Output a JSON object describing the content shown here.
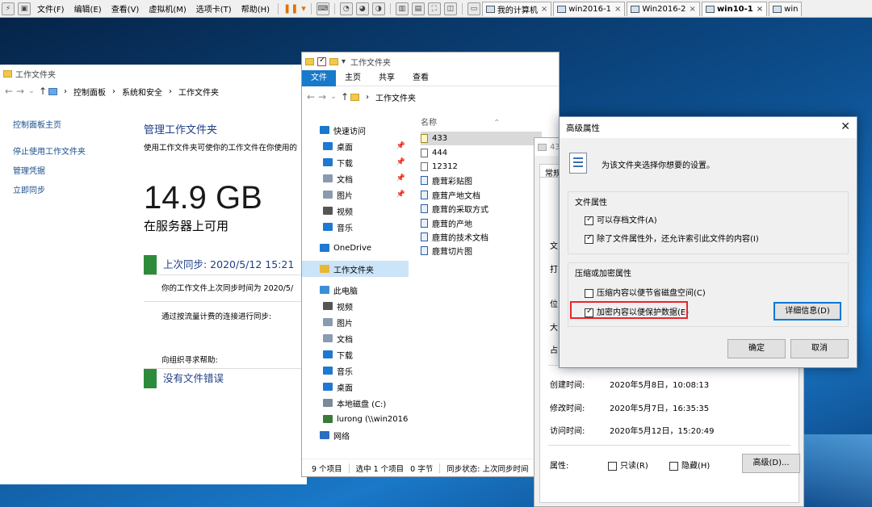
{
  "vmware": {
    "menus": [
      "文件(F)",
      "编辑(E)",
      "查看(V)",
      "虚拟机(M)",
      "选项卡(T)",
      "帮助(H)"
    ],
    "tabs": [
      {
        "label": "我的计算机",
        "active": false
      },
      {
        "label": "win2016-1",
        "active": false
      },
      {
        "label": "Win2016-2",
        "active": false
      },
      {
        "label": "win10-1",
        "active": true
      },
      {
        "label": "win",
        "active": false
      }
    ]
  },
  "control_panel": {
    "title": "工作文件夹",
    "breadcrumb": [
      "控制面板",
      "系统和安全",
      "工作文件夹"
    ],
    "left_links": [
      "控制面板主页",
      "停止使用工作文件夹",
      "管理凭据",
      "立即同步"
    ],
    "heading": "管理工作文件夹",
    "description": "使用工作文件夹可使你的工作文件在你使用的",
    "capacity": "14.9 GB",
    "capacity_label": "在服务器上可用",
    "sync_title": "上次同步: 2020/5/12 15:21",
    "sync_detail": "你的工作文件上次同步时间为 2020/5/",
    "metered_text": "通过按流量计费的连接进行同步:",
    "help_text": "向组织寻求帮助:",
    "error_title": "没有文件错误"
  },
  "explorer": {
    "title": "工作文件夹",
    "ribbon_tabs": [
      "文件",
      "主页",
      "共享",
      "查看"
    ],
    "address": "工作文件夹",
    "nav": [
      {
        "label": "快速访问",
        "icon": "star-icon",
        "color": "#1979ca",
        "pin": false
      },
      {
        "label": "桌面",
        "icon": "desktop-icon",
        "color": "#1f78d1",
        "pin": true
      },
      {
        "label": "下载",
        "icon": "download-icon",
        "color": "#1f78d1",
        "pin": true
      },
      {
        "label": "文档",
        "icon": "document-icon",
        "color": "#8a9bb0",
        "pin": true
      },
      {
        "label": "图片",
        "icon": "picture-icon",
        "color": "#8a9bb0",
        "pin": true
      },
      {
        "label": "视频",
        "icon": "video-icon",
        "color": "#555555",
        "pin": false
      },
      {
        "label": "音乐",
        "icon": "music-icon",
        "color": "#1f78d1",
        "pin": false
      },
      {
        "label": "OneDrive",
        "icon": "cloud-icon",
        "color": "#1f78d1",
        "pin": false
      },
      {
        "label": "工作文件夹",
        "icon": "work-folder-icon",
        "color": "#e9b635",
        "pin": false,
        "selected": true
      },
      {
        "label": "此电脑",
        "icon": "computer-icon",
        "color": "#3a8fd8",
        "pin": false
      },
      {
        "label": "视频",
        "icon": "video-icon",
        "color": "#555555",
        "pin": false
      },
      {
        "label": "图片",
        "icon": "picture-icon",
        "color": "#8a9bb0",
        "pin": false
      },
      {
        "label": "文档",
        "icon": "document-icon",
        "color": "#8a9bb0",
        "pin": false
      },
      {
        "label": "下载",
        "icon": "download-icon",
        "color": "#1f78d1",
        "pin": false
      },
      {
        "label": "音乐",
        "icon": "music-icon",
        "color": "#1f78d1",
        "pin": false
      },
      {
        "label": "桌面",
        "icon": "desktop-icon",
        "color": "#1f78d1",
        "pin": false
      },
      {
        "label": "本地磁盘 (C:)",
        "icon": "drive-icon",
        "color": "#7a8a99",
        "pin": false
      },
      {
        "label": "lurong (\\\\win2016",
        "icon": "network-drive-icon",
        "color": "#3b7a3b",
        "pin": false
      },
      {
        "label": "网络",
        "icon": "network-icon",
        "color": "#2a6fc0",
        "pin": false
      }
    ],
    "column_header": "名称",
    "files": [
      {
        "name": "433",
        "type": "yel",
        "selected": true
      },
      {
        "name": "444",
        "type": "plain"
      },
      {
        "name": "12312",
        "type": "plain"
      },
      {
        "name": "鹿茸彩贴图",
        "type": "blue"
      },
      {
        "name": "鹿茸产地文档",
        "type": "blue"
      },
      {
        "name": "鹿茸的采取方式",
        "type": "blue"
      },
      {
        "name": "鹿茸的产地",
        "type": "blue"
      },
      {
        "name": "鹿茸的技术文档",
        "type": "blue"
      },
      {
        "name": "鹿茸切片图",
        "type": "blue"
      }
    ],
    "status": {
      "items": "9 个项目",
      "selected": "选中 1 个项目",
      "size": "0 字节",
      "sync": "同步状态: 上次同步时间"
    }
  },
  "properties": {
    "title_fragment": "43",
    "tab": "常规",
    "partial_labels": [
      "文",
      "打",
      "位",
      "大",
      "占"
    ],
    "created_label": "创建时间:",
    "created_value": "2020年5月8日，10:08:13",
    "modified_label": "修改时间:",
    "modified_value": "2020年5月7日，16:35:35",
    "accessed_label": "访问时间:",
    "accessed_value": "2020年5月12日，15:20:49",
    "attrs_label": "属性:",
    "readonly_label": "只读(R)",
    "hidden_label": "隐藏(H)",
    "advanced_button": "高级(D)..."
  },
  "advanced_dialog": {
    "title": "高级属性",
    "description": "为该文件夹选择你想要的设置。",
    "file_attr_group": "文件属性",
    "archive_label": "可以存档文件(A)",
    "archive_checked": true,
    "index_label": "除了文件属性外，还允许索引此文件的内容(I)",
    "index_checked": true,
    "compress_group": "压缩或加密属性",
    "compress_label": "压缩内容以便节省磁盘空间(C)",
    "compress_checked": false,
    "encrypt_label": "加密内容以便保护数据(E)",
    "encrypt_checked": true,
    "details_button": "详细信息(D)",
    "ok_button": "确定",
    "cancel_button": "取消",
    "highlight_color": "#e8262b"
  }
}
